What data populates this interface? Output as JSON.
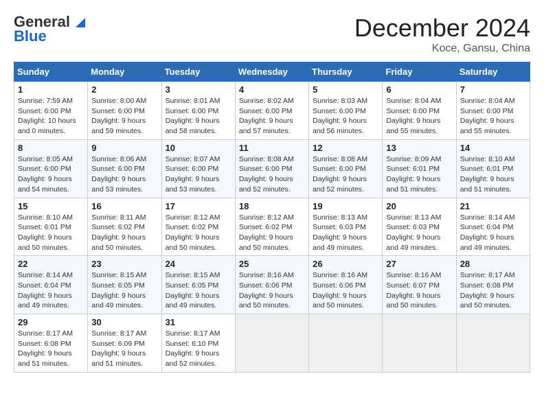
{
  "logo": {
    "line1": "General",
    "line2": "Blue"
  },
  "header": {
    "month": "December 2024",
    "location": "Koce, Gansu, China"
  },
  "weekdays": [
    "Sunday",
    "Monday",
    "Tuesday",
    "Wednesday",
    "Thursday",
    "Friday",
    "Saturday"
  ],
  "weeks": [
    [
      {
        "day": "1",
        "sunrise": "7:59 AM",
        "sunset": "6:00 PM",
        "daylight": "10 hours and 0 minutes."
      },
      {
        "day": "2",
        "sunrise": "8:00 AM",
        "sunset": "6:00 PM",
        "daylight": "9 hours and 59 minutes."
      },
      {
        "day": "3",
        "sunrise": "8:01 AM",
        "sunset": "6:00 PM",
        "daylight": "9 hours and 58 minutes."
      },
      {
        "day": "4",
        "sunrise": "8:02 AM",
        "sunset": "6:00 PM",
        "daylight": "9 hours and 57 minutes."
      },
      {
        "day": "5",
        "sunrise": "8:03 AM",
        "sunset": "6:00 PM",
        "daylight": "9 hours and 56 minutes."
      },
      {
        "day": "6",
        "sunrise": "8:04 AM",
        "sunset": "6:00 PM",
        "daylight": "9 hours and 55 minutes."
      },
      {
        "day": "7",
        "sunrise": "8:04 AM",
        "sunset": "6:00 PM",
        "daylight": "9 hours and 55 minutes."
      }
    ],
    [
      {
        "day": "8",
        "sunrise": "8:05 AM",
        "sunset": "6:00 PM",
        "daylight": "9 hours and 54 minutes."
      },
      {
        "day": "9",
        "sunrise": "8:06 AM",
        "sunset": "6:00 PM",
        "daylight": "9 hours and 53 minutes."
      },
      {
        "day": "10",
        "sunrise": "8:07 AM",
        "sunset": "6:00 PM",
        "daylight": "9 hours and 53 minutes."
      },
      {
        "day": "11",
        "sunrise": "8:08 AM",
        "sunset": "6:00 PM",
        "daylight": "9 hours and 52 minutes."
      },
      {
        "day": "12",
        "sunrise": "8:08 AM",
        "sunset": "6:00 PM",
        "daylight": "9 hours and 52 minutes."
      },
      {
        "day": "13",
        "sunrise": "8:09 AM",
        "sunset": "6:01 PM",
        "daylight": "9 hours and 51 minutes."
      },
      {
        "day": "14",
        "sunrise": "8:10 AM",
        "sunset": "6:01 PM",
        "daylight": "9 hours and 51 minutes."
      }
    ],
    [
      {
        "day": "15",
        "sunrise": "8:10 AM",
        "sunset": "6:01 PM",
        "daylight": "9 hours and 50 minutes."
      },
      {
        "day": "16",
        "sunrise": "8:11 AM",
        "sunset": "6:02 PM",
        "daylight": "9 hours and 50 minutes."
      },
      {
        "day": "17",
        "sunrise": "8:12 AM",
        "sunset": "6:02 PM",
        "daylight": "9 hours and 50 minutes."
      },
      {
        "day": "18",
        "sunrise": "8:12 AM",
        "sunset": "6:02 PM",
        "daylight": "9 hours and 50 minutes."
      },
      {
        "day": "19",
        "sunrise": "8:13 AM",
        "sunset": "6:03 PM",
        "daylight": "9 hours and 49 minutes."
      },
      {
        "day": "20",
        "sunrise": "8:13 AM",
        "sunset": "6:03 PM",
        "daylight": "9 hours and 49 minutes."
      },
      {
        "day": "21",
        "sunrise": "8:14 AM",
        "sunset": "6:04 PM",
        "daylight": "9 hours and 49 minutes."
      }
    ],
    [
      {
        "day": "22",
        "sunrise": "8:14 AM",
        "sunset": "6:04 PM",
        "daylight": "9 hours and 49 minutes."
      },
      {
        "day": "23",
        "sunrise": "8:15 AM",
        "sunset": "6:05 PM",
        "daylight": "9 hours and 49 minutes."
      },
      {
        "day": "24",
        "sunrise": "8:15 AM",
        "sunset": "6:05 PM",
        "daylight": "9 hours and 49 minutes."
      },
      {
        "day": "25",
        "sunrise": "8:16 AM",
        "sunset": "6:06 PM",
        "daylight": "9 hours and 50 minutes."
      },
      {
        "day": "26",
        "sunrise": "8:16 AM",
        "sunset": "6:06 PM",
        "daylight": "9 hours and 50 minutes."
      },
      {
        "day": "27",
        "sunrise": "8:16 AM",
        "sunset": "6:07 PM",
        "daylight": "9 hours and 50 minutes."
      },
      {
        "day": "28",
        "sunrise": "8:17 AM",
        "sunset": "6:08 PM",
        "daylight": "9 hours and 50 minutes."
      }
    ],
    [
      {
        "day": "29",
        "sunrise": "8:17 AM",
        "sunset": "6:08 PM",
        "daylight": "9 hours and 51 minutes."
      },
      {
        "day": "30",
        "sunrise": "8:17 AM",
        "sunset": "6:09 PM",
        "daylight": "9 hours and 51 minutes."
      },
      {
        "day": "31",
        "sunrise": "8:17 AM",
        "sunset": "6:10 PM",
        "daylight": "9 hours and 52 minutes."
      },
      null,
      null,
      null,
      null
    ]
  ]
}
